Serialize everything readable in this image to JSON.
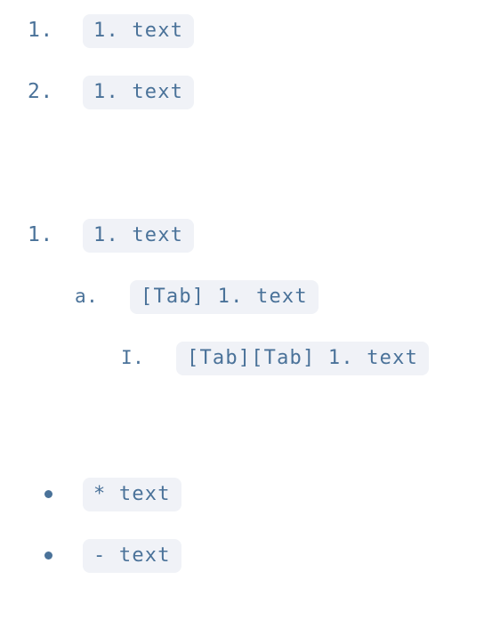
{
  "document": {
    "kind": "markdown-list-syntax-reference",
    "background_color": "#ffffff",
    "text_color": "#4a7299",
    "chip_background_color": "#f0f2f7"
  },
  "blocks": [
    {
      "id": "ordered-basic",
      "list_type": "ordered-decimal",
      "rows": [
        {
          "marker": "1.",
          "level": 1,
          "code": "1. text"
        },
        {
          "marker": "2.",
          "level": 1,
          "code": "1. text"
        }
      ]
    },
    {
      "id": "ordered-nested",
      "list_type": "ordered-nested",
      "rows": [
        {
          "marker": "1.",
          "level": 1,
          "code": "1. text"
        },
        {
          "marker": "a.",
          "level": 2,
          "code": "[Tab] 1. text"
        },
        {
          "marker": "I.",
          "level": 3,
          "code": "[Tab][Tab] 1. text"
        }
      ]
    },
    {
      "id": "unordered",
      "list_type": "unordered-bullet",
      "rows": [
        {
          "marker": "•",
          "level": 1,
          "code": "* text"
        },
        {
          "marker": "•",
          "level": 1,
          "code": "- text"
        }
      ]
    }
  ]
}
